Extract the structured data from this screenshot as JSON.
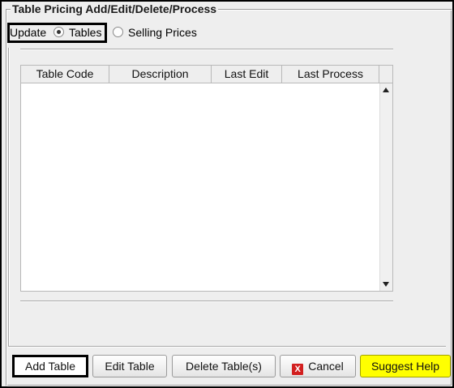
{
  "group": {
    "title": "Table Pricing Add/Edit/Delete/Process"
  },
  "mode": {
    "label": "Update",
    "options": [
      {
        "label": "Tables",
        "selected": true
      },
      {
        "label": "Selling Prices",
        "selected": false
      }
    ]
  },
  "table": {
    "columns": [
      "Table Code",
      "Description",
      "Last Edit",
      "Last Process"
    ],
    "rows": []
  },
  "buttons": {
    "add": "Add Table",
    "edit": "Edit Table",
    "delete": "Delete Table(s)",
    "cancel": "Cancel",
    "cancel_icon": "X",
    "help": "Suggest Help"
  },
  "colors": {
    "help_button": "#ffff00",
    "cancel_icon": "#d21f1f"
  }
}
